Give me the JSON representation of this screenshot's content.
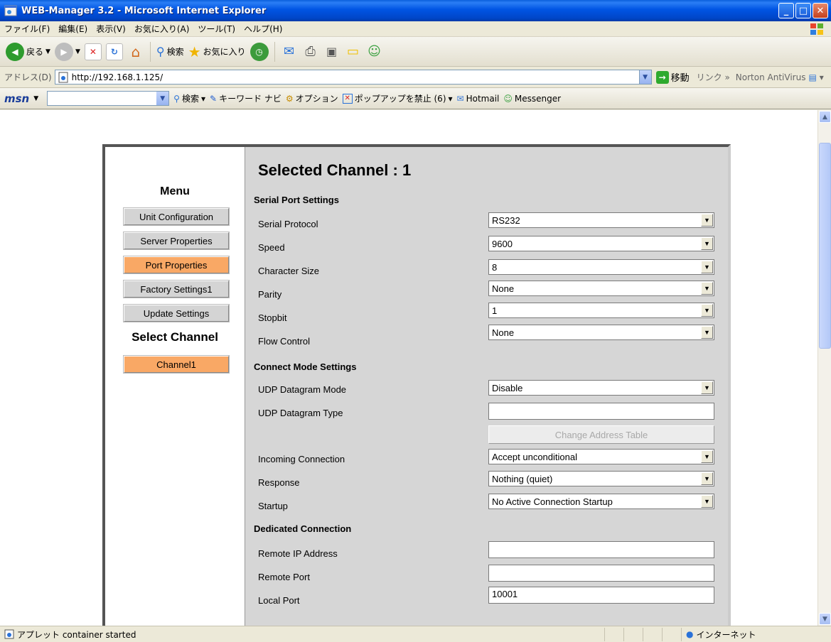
{
  "window": {
    "title": "WEB-Manager 3.2 - Microsoft Internet Explorer"
  },
  "menubar": [
    "ファイル(F)",
    "編集(E)",
    "表示(V)",
    "お気に入り(A)",
    "ツール(T)",
    "ヘルプ(H)"
  ],
  "toolbar": {
    "back": "戻る",
    "search": "検索",
    "favorites": "お気に入り"
  },
  "address": {
    "label": "アドレス(D)",
    "url": "http://192.168.1.125/",
    "go": "移動",
    "links": "リンク",
    "norton": "Norton AntiVirus"
  },
  "msnbar": {
    "logo": "msn",
    "search": "検索",
    "keyword": "キーワード ナビ",
    "options": "オプション",
    "popup": "ポップアップを禁止 (6)",
    "hotmail": "Hotmail",
    "messenger": "Messenger"
  },
  "sidebar": {
    "menu_title": "Menu",
    "items": [
      {
        "label": "Unit Configuration",
        "active": false
      },
      {
        "label": "Server Properties",
        "active": false
      },
      {
        "label": "Port Properties",
        "active": true
      },
      {
        "label": "Factory Settings1",
        "active": false
      },
      {
        "label": "Update Settings",
        "active": false
      }
    ],
    "select_channel_title": "Select Channel",
    "channel": "Channel1"
  },
  "main": {
    "title": "Selected Channel : 1",
    "serial_section": "Serial Port Settings",
    "serial_protocol": {
      "label": "Serial Protocol",
      "value": "RS232"
    },
    "speed": {
      "label": "Speed",
      "value": "9600"
    },
    "char_size": {
      "label": "Character Size",
      "value": "8"
    },
    "parity": {
      "label": "Parity",
      "value": "None"
    },
    "stopbit": {
      "label": "Stopbit",
      "value": "1"
    },
    "flow": {
      "label": "Flow Control",
      "value": "None"
    },
    "connect_section": "Connect Mode Settings",
    "udp_mode": {
      "label": "UDP Datagram Mode",
      "value": "Disable"
    },
    "udp_type": {
      "label": "UDP Datagram Type",
      "value": ""
    },
    "change_addr": "Change Address Table",
    "incoming": {
      "label": "Incoming Connection",
      "value": "Accept unconditional"
    },
    "response": {
      "label": "Response",
      "value": "Nothing (quiet)"
    },
    "startup": {
      "label": "Startup",
      "value": "No Active Connection Startup"
    },
    "dedicated_section": "Dedicated Connection",
    "remote_ip": {
      "label": "Remote IP Address",
      "value": ""
    },
    "remote_port": {
      "label": "Remote Port",
      "value": ""
    },
    "local_port": {
      "label": "Local Port",
      "value": "10001"
    }
  },
  "statusbar": {
    "message": "アプレット container started",
    "zone": "インターネット"
  },
  "colors": {
    "active_nav": "#f9a865",
    "panel": "#d6d6d6"
  }
}
